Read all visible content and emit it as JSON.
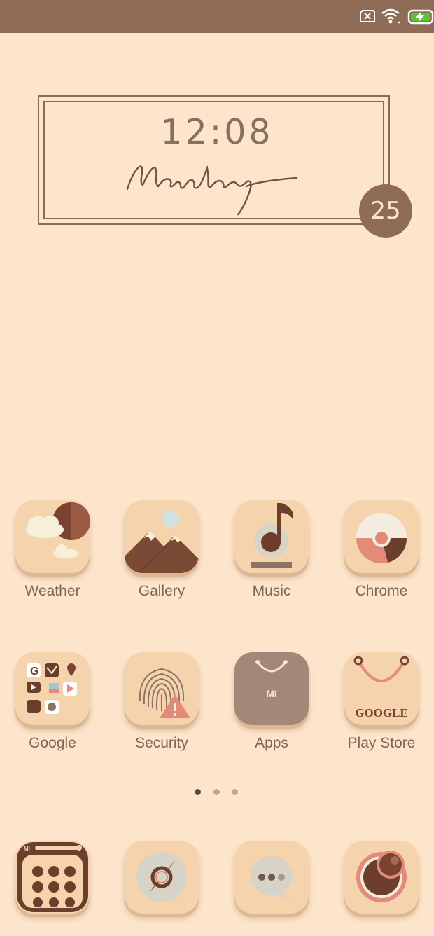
{
  "status_bar": {
    "icons": [
      "sim-off-icon",
      "wifi-icon",
      "battery-charging-icon"
    ],
    "battery_color": "#5ac33a"
  },
  "clock_widget": {
    "time": "12:08",
    "day": "Monday",
    "date": "25"
  },
  "home_grid": [
    {
      "label": "Weather",
      "icon": "weather-icon"
    },
    {
      "label": "Gallery",
      "icon": "gallery-icon"
    },
    {
      "label": "Music",
      "icon": "music-icon"
    },
    {
      "label": "Chrome",
      "icon": "chrome-icon"
    },
    {
      "label": "Google",
      "icon": "google-folder-icon"
    },
    {
      "label": "Security",
      "icon": "security-icon"
    },
    {
      "label": "Apps",
      "icon": "mi-apps-icon"
    },
    {
      "label": "Play Store",
      "icon": "play-store-icon"
    }
  ],
  "icon_text": {
    "mi": "MI",
    "google": "GOOGLE"
  },
  "page_indicator": {
    "pages": 3,
    "current": 1
  },
  "dock": [
    {
      "icon": "phone-dialer-icon"
    },
    {
      "icon": "browser-compass-icon"
    },
    {
      "icon": "messages-icon"
    },
    {
      "icon": "camera-icon"
    }
  ],
  "colors": {
    "background": "#fde5cb",
    "status_bar": "#8e6c55",
    "icon_tile": "#f5d4ad",
    "accent_brown": "#6b3f2c",
    "accent_coral": "#e48a7a",
    "text": "#7e6656"
  }
}
